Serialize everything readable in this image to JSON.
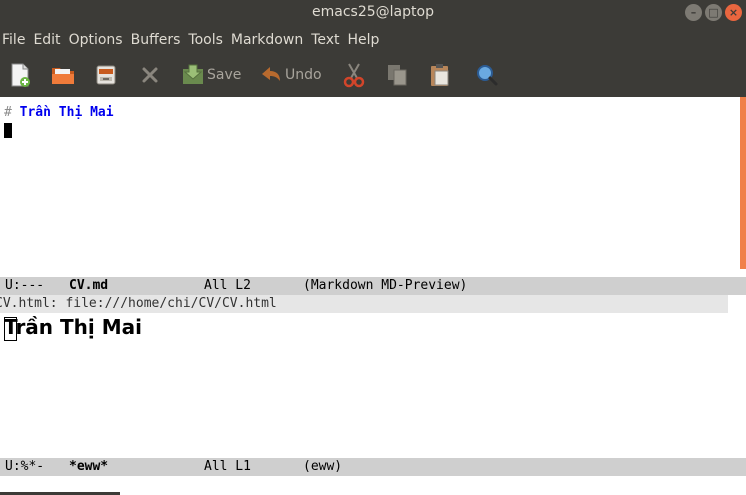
{
  "window": {
    "title": "emacs25@laptop"
  },
  "menubar": {
    "items": [
      "File",
      "Edit",
      "Options",
      "Buffers",
      "Tools",
      "Markdown",
      "Text",
      "Help"
    ]
  },
  "toolbar": {
    "save_label": "Save",
    "undo_label": "Undo"
  },
  "top_window": {
    "hash": "#",
    "heading": "Trần Thị Mai"
  },
  "top_modeline": {
    "status": "U:---",
    "buffer": "CV.md",
    "position": "All L2",
    "modes": "(Markdown MD-Preview)"
  },
  "eww_header": {
    "text": "CV.html: file:///home/chi/CV/CV.html"
  },
  "bottom_window": {
    "heading": "Trần Thị Mai"
  },
  "bottom_modeline": {
    "status": "U:%*-",
    "buffer": "*eww*",
    "position": "All L1",
    "modes": "(eww)"
  },
  "colors": {
    "chrome": "#3c3b37",
    "heading_markup": "#0000ee",
    "modeline": "#cfcfcf",
    "scroll_thumb": "#f0804a"
  }
}
